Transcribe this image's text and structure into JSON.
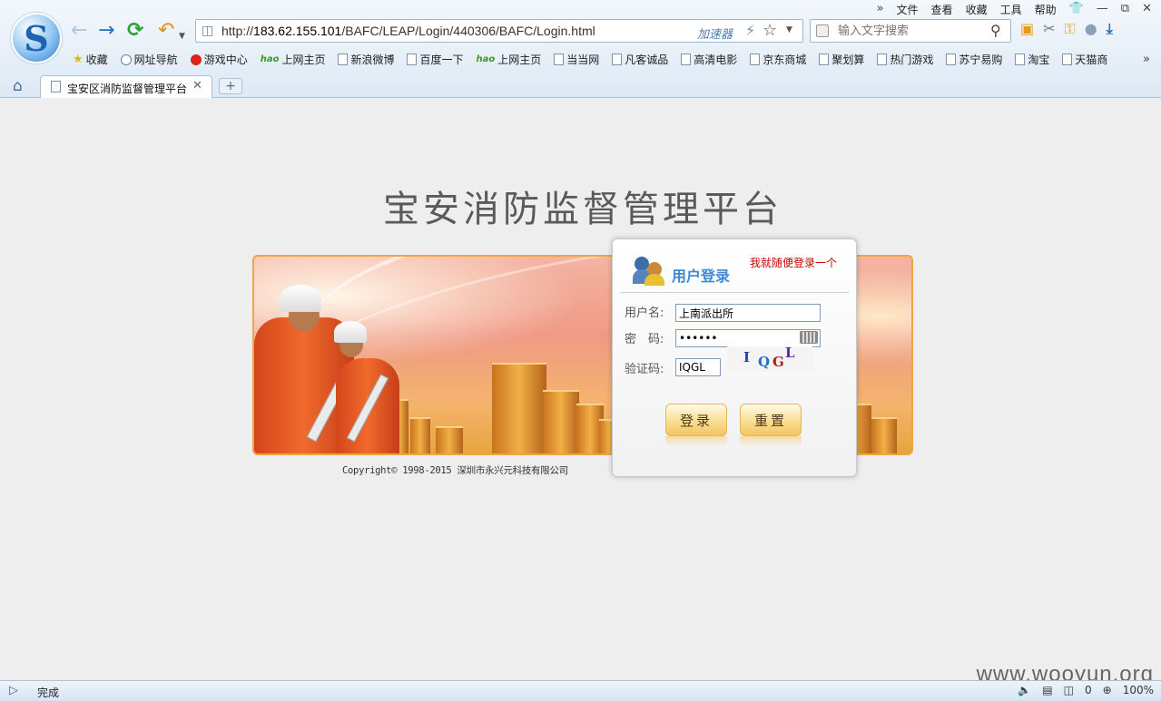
{
  "browser": {
    "logo_letter": "S",
    "menu": [
      "文件",
      "查看",
      "收藏",
      "工具",
      "帮助"
    ],
    "menu_more": "»",
    "url_prefix": "http://",
    "url_host": "183.62.155.101",
    "url_path": "/BAFC/LEAP/Login/440306/BAFC/Login.html",
    "accelerator": "加速器",
    "search_placeholder": "输入文字搜索",
    "bookmarks": [
      {
        "label": "收藏",
        "icon": "star"
      },
      {
        "label": "网址导航",
        "icon": "globe"
      },
      {
        "label": "游戏中心",
        "icon": "game"
      },
      {
        "label": "上网主页",
        "icon": "hao"
      },
      {
        "label": "新浪微博",
        "icon": "page"
      },
      {
        "label": "百度一下",
        "icon": "page"
      },
      {
        "label": "上网主页",
        "icon": "hao"
      },
      {
        "label": "当当网",
        "icon": "page"
      },
      {
        "label": "凡客诚品",
        "icon": "page"
      },
      {
        "label": "高清电影",
        "icon": "page"
      },
      {
        "label": "京东商城",
        "icon": "page"
      },
      {
        "label": "聚划算",
        "icon": "page"
      },
      {
        "label": "热门游戏",
        "icon": "page"
      },
      {
        "label": "苏宁易购",
        "icon": "page"
      },
      {
        "label": "淘宝",
        "icon": "page"
      },
      {
        "label": "天猫商",
        "icon": "page"
      }
    ],
    "hao_text": "hao",
    "tab_title": "宝安区消防监督管理平台",
    "new_tab": "+"
  },
  "page": {
    "title": "宝安消防监督管理平台",
    "copyright": "Copyright© 1998-2015 深圳市永兴元科技有限公司"
  },
  "login": {
    "heading": "用户登录",
    "note": "我就随便登录一个",
    "username_label": "用户名:",
    "username_value": "上南派出所",
    "password_label": "密　码:",
    "password_value": "••••••",
    "captcha_label": "验证码:",
    "captcha_value": "IQGL",
    "captcha_chars": [
      "I",
      "Q",
      "G",
      "L"
    ],
    "login_button": "登录",
    "reset_button": "重置"
  },
  "status": {
    "text": "完成",
    "count": "0",
    "zoom": "100%"
  },
  "watermark": "www.wooyun.org",
  "colors": {
    "accent_blue": "#3d8ad6",
    "note_red": "#cc0000",
    "banner_border": "#e9a743"
  }
}
